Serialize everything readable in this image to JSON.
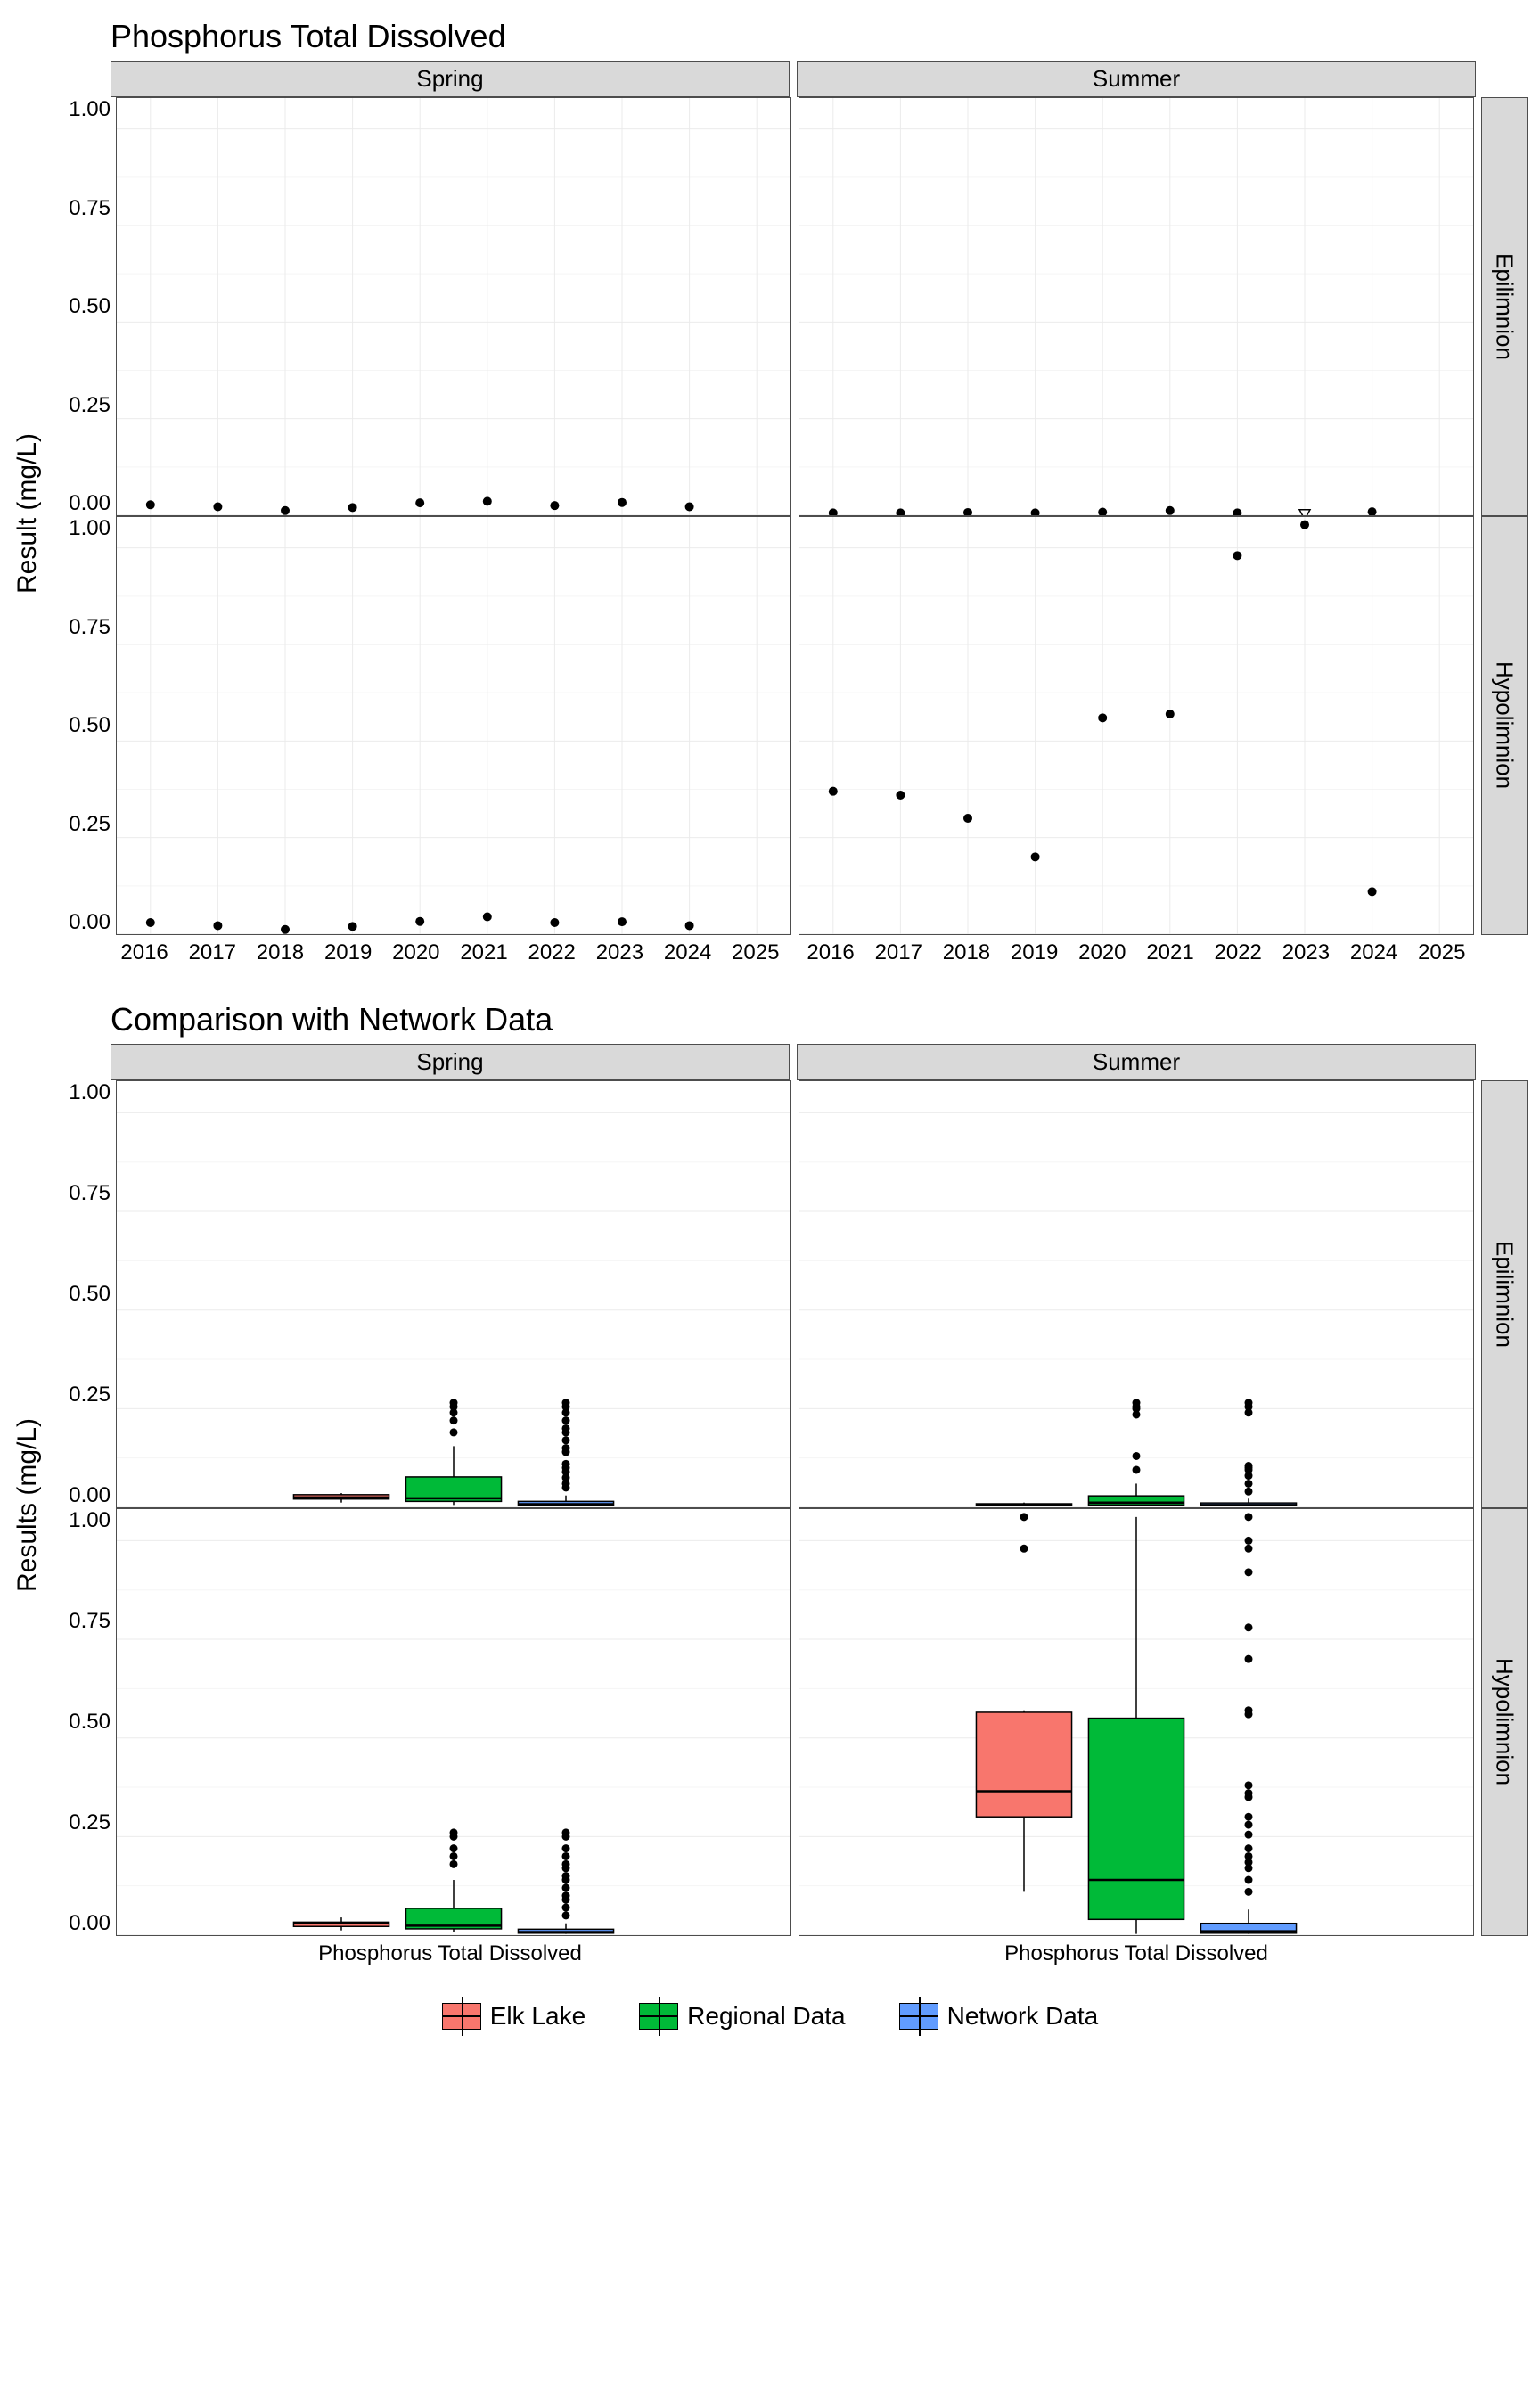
{
  "chart_data": [
    {
      "id": "ts",
      "type": "scatter",
      "title": "Phosphorus Total Dissolved",
      "ylabel": "Result (mg/L)",
      "xlabel": "",
      "col_facets": [
        "Spring",
        "Summer"
      ],
      "row_facets": [
        "Epilimnion",
        "Hypolimnion"
      ],
      "x_ticks": [
        "2016",
        "2017",
        "2018",
        "2019",
        "2020",
        "2021",
        "2022",
        "2023",
        "2024",
        "2025"
      ],
      "y_ticks": [
        "0.00",
        "0.25",
        "0.50",
        "0.75",
        "1.00"
      ],
      "ylim": [
        0.0,
        1.08
      ],
      "series": {
        "Spring|Epilimnion": {
          "x": [
            2016,
            2017,
            2018,
            2019,
            2020,
            2021,
            2022,
            2023,
            2024
          ],
          "y": [
            0.027,
            0.022,
            0.012,
            0.02,
            0.032,
            0.036,
            0.025,
            0.033,
            0.022
          ],
          "sym": [
            "c",
            "c",
            "c",
            "c",
            "c",
            "c",
            "c",
            "c",
            "c"
          ]
        },
        "Summer|Epilimnion": {
          "x": [
            2016,
            2017,
            2018,
            2019,
            2020,
            2021,
            2022,
            2023,
            2024
          ],
          "y": [
            0.006,
            0.006,
            0.007,
            0.006,
            0.008,
            0.012,
            0.006,
            0.003,
            0.009
          ],
          "sym": [
            "c",
            "c",
            "c",
            "c",
            "c",
            "c",
            "c",
            "t",
            "c"
          ]
        },
        "Spring|Hypolimnion": {
          "x": [
            2016,
            2017,
            2018,
            2019,
            2020,
            2021,
            2022,
            2023,
            2024
          ],
          "y": [
            0.03,
            0.022,
            0.012,
            0.02,
            0.033,
            0.045,
            0.03,
            0.032,
            0.022
          ],
          "sym": [
            "c",
            "c",
            "c",
            "c",
            "c",
            "c",
            "c",
            "c",
            "c"
          ]
        },
        "Summer|Hypolimnion": {
          "x": [
            2016,
            2017,
            2018,
            2019,
            2020,
            2021,
            2022,
            2023,
            2024
          ],
          "y": [
            0.37,
            0.36,
            0.3,
            0.2,
            0.56,
            0.57,
            0.98,
            1.06,
            0.11
          ],
          "sym": [
            "c",
            "c",
            "c",
            "c",
            "c",
            "c",
            "c",
            "c",
            "c"
          ]
        }
      }
    },
    {
      "id": "box",
      "type": "boxplot",
      "title": "Comparison with Network Data",
      "ylabel": "Results (mg/L)",
      "xlabel": "",
      "col_facets": [
        "Spring",
        "Summer"
      ],
      "row_facets": [
        "Epilimnion",
        "Hypolimnion"
      ],
      "x_category": "Phosphorus Total Dissolved",
      "y_ticks": [
        "0.00",
        "0.25",
        "0.50",
        "0.75",
        "1.00"
      ],
      "ylim": [
        0.0,
        1.08
      ],
      "groups": [
        "Elk Lake",
        "Regional Data",
        "Network Data"
      ],
      "colors": {
        "Elk Lake": "#f8766d",
        "Regional Data": "#00ba38",
        "Network Data": "#619cff"
      },
      "cells": {
        "Spring|Epilimnion": [
          {
            "g": "Elk Lake",
            "min": 0.012,
            "q1": 0.021,
            "med": 0.025,
            "q3": 0.032,
            "max": 0.036,
            "out": []
          },
          {
            "g": "Regional Data",
            "min": 0.006,
            "q1": 0.015,
            "med": 0.023,
            "q3": 0.077,
            "max": 0.155,
            "out": [
              0.19,
              0.22,
              0.24,
              0.255,
              0.265
            ]
          },
          {
            "g": "Network Data",
            "min": 0.003,
            "q1": 0.005,
            "med": 0.008,
            "q3": 0.015,
            "max": 0.03,
            "out": [
              0.05,
              0.06,
              0.075,
              0.09,
              0.1,
              0.11,
              0.14,
              0.15,
              0.17,
              0.19,
              0.2,
              0.22,
              0.24,
              0.255,
              0.265
            ]
          }
        ],
        "Summer|Epilimnion": [
          {
            "g": "Elk Lake",
            "min": 0.003,
            "q1": 0.006,
            "med": 0.006,
            "q3": 0.009,
            "max": 0.012,
            "out": []
          },
          {
            "g": "Regional Data",
            "min": 0.003,
            "q1": 0.006,
            "med": 0.012,
            "q3": 0.029,
            "max": 0.06,
            "out": [
              0.095,
              0.13,
              0.235,
              0.25,
              0.255,
              0.265
            ]
          },
          {
            "g": "Network Data",
            "min": 0.003,
            "q1": 0.004,
            "med": 0.006,
            "q3": 0.011,
            "max": 0.022,
            "out": [
              0.04,
              0.06,
              0.08,
              0.095,
              0.1,
              0.105,
              0.24,
              0.255,
              0.265
            ]
          }
        ],
        "Spring|Hypolimnion": [
          {
            "g": "Elk Lake",
            "min": 0.012,
            "q1": 0.022,
            "med": 0.03,
            "q3": 0.033,
            "max": 0.045,
            "out": []
          },
          {
            "g": "Regional Data",
            "min": 0.008,
            "q1": 0.016,
            "med": 0.024,
            "q3": 0.068,
            "max": 0.14,
            "out": [
              0.18,
              0.2,
              0.22,
              0.25,
              0.26
            ]
          },
          {
            "g": "Network Data",
            "min": 0.003,
            "q1": 0.005,
            "med": 0.008,
            "q3": 0.015,
            "max": 0.03,
            "out": [
              0.05,
              0.07,
              0.09,
              0.1,
              0.12,
              0.14,
              0.15,
              0.17,
              0.18,
              0.2,
              0.22,
              0.25,
              0.26
            ]
          }
        ],
        "Summer|Hypolimnion": [
          {
            "g": "Elk Lake",
            "min": 0.11,
            "q1": 0.3,
            "med": 0.365,
            "q3": 0.565,
            "max": 0.57,
            "out": [
              0.98,
              1.06
            ]
          },
          {
            "g": "Regional Data",
            "min": 0.003,
            "q1": 0.04,
            "med": 0.14,
            "q3": 0.55,
            "max": 1.06,
            "out": []
          },
          {
            "g": "Network Data",
            "min": 0.003,
            "q1": 0.005,
            "med": 0.01,
            "q3": 0.03,
            "max": 0.065,
            "out": [
              0.11,
              0.14,
              0.17,
              0.185,
              0.2,
              0.22,
              0.255,
              0.28,
              0.3,
              0.35,
              0.36,
              0.38,
              0.56,
              0.57,
              0.7,
              0.78,
              0.92,
              0.98,
              1.0,
              1.06
            ]
          }
        ]
      }
    }
  ],
  "legend": {
    "items": [
      {
        "label": "Elk Lake",
        "color": "#f8766d"
      },
      {
        "label": "Regional Data",
        "color": "#00ba38"
      },
      {
        "label": "Network Data",
        "color": "#619cff"
      }
    ]
  }
}
